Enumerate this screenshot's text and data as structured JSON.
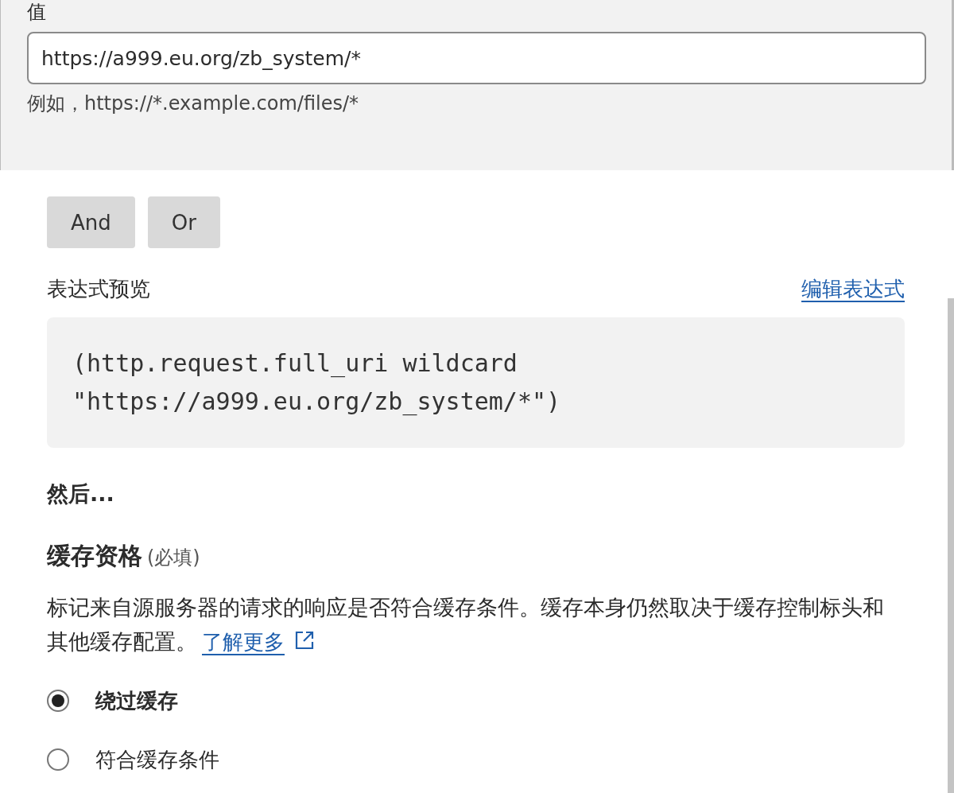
{
  "value_field": {
    "label": "值",
    "value": "https://a999.eu.org/zb_system/*",
    "hint": "例如，https://*.example.com/files/*"
  },
  "operator_buttons": [
    "And",
    "Or"
  ],
  "expression_preview": {
    "label": "表达式预览",
    "edit_link": "编辑表达式",
    "code": "(http.request.full_uri wildcard\n\"https://a999.eu.org/zb_system/*\")"
  },
  "then_heading": "然后...",
  "cache_eligibility": {
    "title": "缓存资格",
    "required": "(必填)",
    "description": "标记来自源服务器的请求的响应是否符合缓存条件。缓存本身仍然取决于缓存控制标头和其他缓存配置。",
    "learn_more": "了解更多",
    "options": [
      {
        "label": "绕过缓存",
        "selected": true
      },
      {
        "label": "符合缓存条件",
        "selected": false
      }
    ]
  }
}
